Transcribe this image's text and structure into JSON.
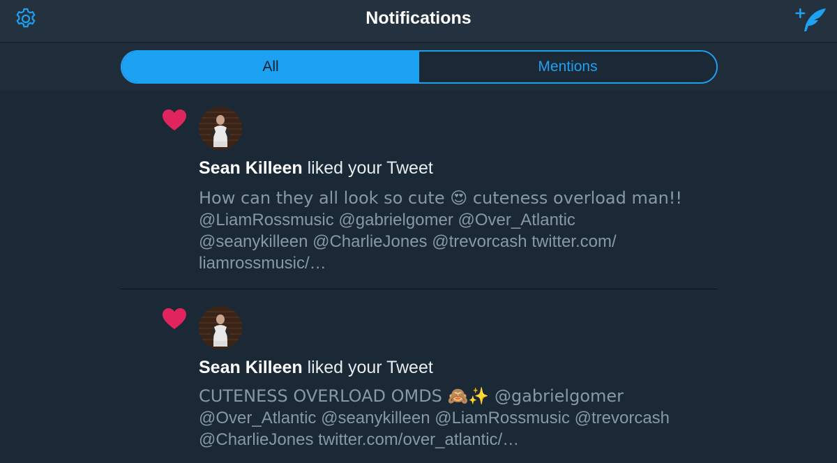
{
  "header": {
    "title": "Notifications",
    "settings_icon": "gear-icon",
    "compose_icon": "compose-tweet-icon"
  },
  "tabs": [
    {
      "label": "All",
      "active": true
    },
    {
      "label": "Mentions",
      "active": false
    }
  ],
  "notifications": [
    {
      "icon": "heart-icon",
      "actor": "Sean Killeen",
      "action": " liked your Tweet",
      "text_lines": [
        "How can they all look so cute 😍  cuteness overload man!!",
        "@LiamRossmusic @gabrielgomer @Over_Atlantic",
        "@seanykilleen @CharlieJones @trevorcash twitter.com/",
        "liamrossmusic/…"
      ]
    },
    {
      "icon": "heart-icon",
      "actor": "Sean Killeen",
      "action": " liked your Tweet",
      "text_lines": [
        "CUTENESS OVERLOAD OMDS 🙈✨  @gabrielgomer",
        "@Over_Atlantic @seanykilleen @LiamRossmusic @trevorcash",
        "@CharlieJones twitter.com/over_atlantic/…"
      ]
    }
  ],
  "colors": {
    "accent": "#1da1f2",
    "heart": "#e0245e",
    "background": "#1b2836",
    "header_bg": "#24313f",
    "muted_text": "#8899a6"
  }
}
